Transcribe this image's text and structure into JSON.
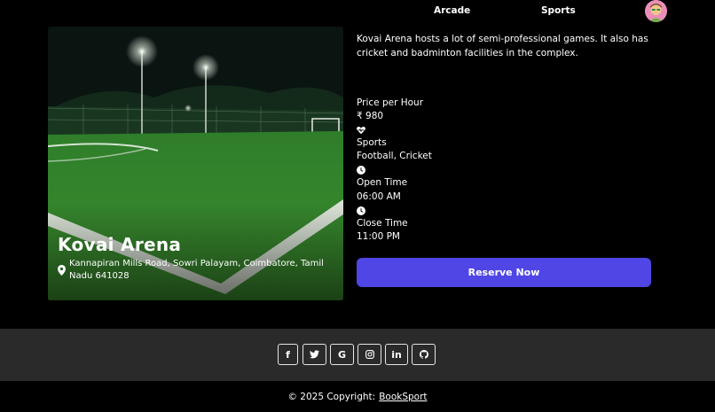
{
  "nav": {
    "items": [
      "Arcade",
      "Sports"
    ]
  },
  "venue": {
    "name": "Kovai Arena",
    "address": "Kannapiran Mills Road, Sowri Palayam, Coimbatore, Tamil Nadu 641028",
    "description": "Kovai Arena hosts a lot of semi-professional games. It also has cricket and badminton facilities in the complex."
  },
  "details": {
    "price_label": "Price per Hour",
    "price_value": "₹ 980",
    "sports_label": "Sports",
    "sports_value": "Football, Cricket",
    "open_label": "Open Time",
    "open_value": "06:00 AM",
    "close_label": "Close Time",
    "close_value": "11:00 PM"
  },
  "actions": {
    "reserve": "Reserve Now"
  },
  "social": {
    "icons": [
      "facebook-icon",
      "twitter-icon",
      "google-icon",
      "instagram-icon",
      "linkedin-icon",
      "github-icon"
    ],
    "glyphs": [
      "f",
      "🐦",
      "G",
      "◎",
      "in",
      "◉"
    ]
  },
  "footer": {
    "copyright": "© 2025 Copyright:",
    "brand": "BookSport"
  },
  "colors": {
    "accent": "#4f46e5",
    "footer_bg": "#2a2a2a",
    "background": "#000000"
  }
}
